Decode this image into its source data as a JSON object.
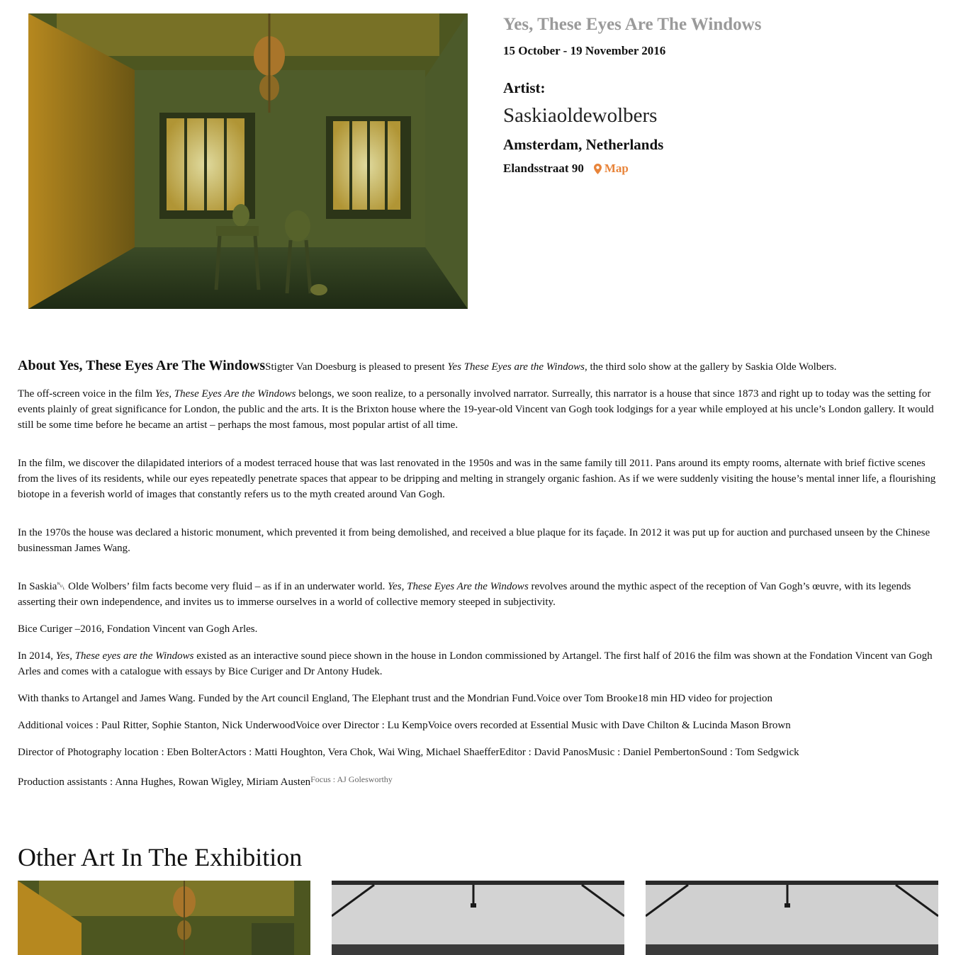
{
  "exhibition": {
    "title": "Yes, These Eyes Are The Windows",
    "dates": "15 October - 19 November 2016",
    "artist_label": "Artist:",
    "artist_name": "Saskiaoldewolbers",
    "city": "Amsterdam, Netherlands",
    "address": "Elandsstraat 90",
    "map_label": "Map"
  },
  "about": {
    "heading": "About Yes, These Eyes Are The Windows",
    "intro_pre": "Stigter Van Doesburg is pleased to present ",
    "intro_em": "Yes These Eyes are the Windows",
    "intro_post": ", the third solo show at the gallery by Saskia Olde Wolbers.",
    "p1_pre": "The off-screen voice in the film ",
    "p1_em": "Yes, These Eyes Are the Windows",
    "p1_post": " belongs, we soon realize, to a personally involved narrator. Surreally, this narrator is a house that since 1873 and right up to today was the setting for events plainly of great significance for London, the public and the arts. It is the Brixton house where the 19-year-old Vincent van Gogh took lodgings for a year while employed at his uncle’s London gallery. It would still be some time before he became an artist – perhaps the most famous, most popular artist of all time.",
    "p2": "In the film, we discover the dilapidated interiors of a modest terraced house that was last renovated in the 1950s and was in the same family till 2011. Pans around its empty rooms, alternate with brief fictive scenes from the lives of its residents, while our eyes repeatedly penetrate spaces that appear to be dripping and melting in strangely organic fashion. As if we were suddenly visiting the house’s mental inner life, a flourishing biotope in a feverish world of images that constantly refers us to the myth created around Van Gogh.",
    "p3": "In the 1970s the house was declared a historic monument, which prevented it from being demolished, and received a blue plaque for its façade. In 2012 it was put up for auction and purchased unseen by the Chinese businessman James Wang.",
    "p4_pre": "In Saskia␀ Olde Wolbers’ film facts become very fluid – as if in an underwater world. ",
    "p4_em": "Yes, These Eyes Are the Windows",
    "p4_post": " revolves around the mythic aspect of the reception of Van Gogh’s œuvre, with its legends asserting their own independence, and invites us to immerse ourselves in a world of collective memory steeped in subjectivity.",
    "p5": "Bice Curiger –2016, Fondation Vincent van Gogh Arles.",
    "p6_pre": "In 2014, ",
    "p6_em": "Yes, These eyes are the Windows",
    "p6_post": " existed as an interactive sound piece shown in the house in London commissioned by Artangel. The first half of 2016 the film was shown at the Fondation Vincent van Gogh Arles and comes with a catalogue with essays by Bice Curiger and Dr Antony Hudek.",
    "p7": "With thanks to Artangel and James Wang. Funded by the Art council England, The Elephant trust and the Mondrian Fund.Voice over Tom Brooke18 min HD video for projection",
    "p8": "Additional voices : Paul Ritter, Sophie Stanton, Nick UnderwoodVoice over Director : Lu KempVoice overs recorded at Essential Music with Dave Chilton & Lucinda Mason Brown",
    "p9": "Director of Photography location : Eben BolterActors : Matti Houghton, Vera Chok, Wai Wing, Michael ShaefferEditor : David PanosMusic : Daniel PembertonSound : Tom Sedgwick",
    "p10": "Production assistants : Anna Hughes, Rowan Wigley, Miriam Austen",
    "p10_small": "Focus : AJ Golesworthy"
  },
  "other": {
    "heading": "Other Art In The Exhibition"
  },
  "colors": {
    "title_gray": "#9a9a9a",
    "map_orange": "#e8843a"
  },
  "icons": {
    "map_pin": "map-pin-icon"
  }
}
